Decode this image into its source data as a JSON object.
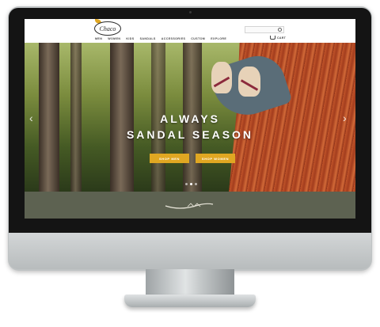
{
  "site": {
    "logo_text": "Chaco",
    "nav": [
      "MEN",
      "WOMEN",
      "KIDS",
      "SANDALS",
      "ACCESSORIES",
      "CUSTOM",
      "EXPLORE"
    ],
    "cart_label": "CART",
    "search_icon": "magnifier"
  },
  "hero": {
    "title_line1": "ALWAYS",
    "title_line2": "SANDAL SEASON",
    "buttons": [
      "SHOP MEN",
      "SHOP WOMEN"
    ],
    "slide_count": 3,
    "active_slide": 1
  },
  "colors": {
    "accent": "#e0a722",
    "band": "#5d6251",
    "bezel": "#141414"
  }
}
